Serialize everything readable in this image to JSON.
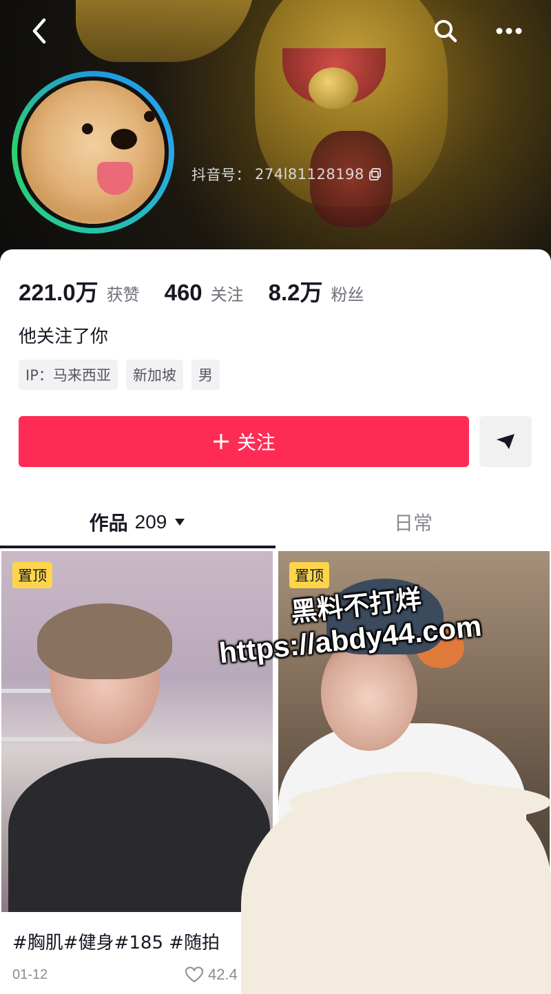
{
  "header": {
    "id_label": "抖音号：",
    "id_value": "274l81128198"
  },
  "stats": [
    {
      "value": "221.0万",
      "label": "获赞"
    },
    {
      "value": "460",
      "label": "关注"
    },
    {
      "value": "8.2万",
      "label": "粉丝"
    }
  ],
  "follow_note": "他关注了你",
  "tags": [
    "IP：马来西亚",
    "新加坡",
    "男"
  ],
  "follow_button": "关注",
  "tabs": {
    "works_label": "作品",
    "works_count": "209",
    "daily_label": "日常"
  },
  "videos": [
    {
      "pin": "置顶"
    },
    {
      "pin": "置顶"
    }
  ],
  "watermark": {
    "line1": "黑料不打烊",
    "line2": "https://abdy44.com"
  },
  "post": {
    "caption": "#胸肌#健身#185 #随拍",
    "date": "01-12",
    "likes": "42.4"
  },
  "colors": {
    "accent": "#fe2c55",
    "pin": "#fdd54a"
  }
}
